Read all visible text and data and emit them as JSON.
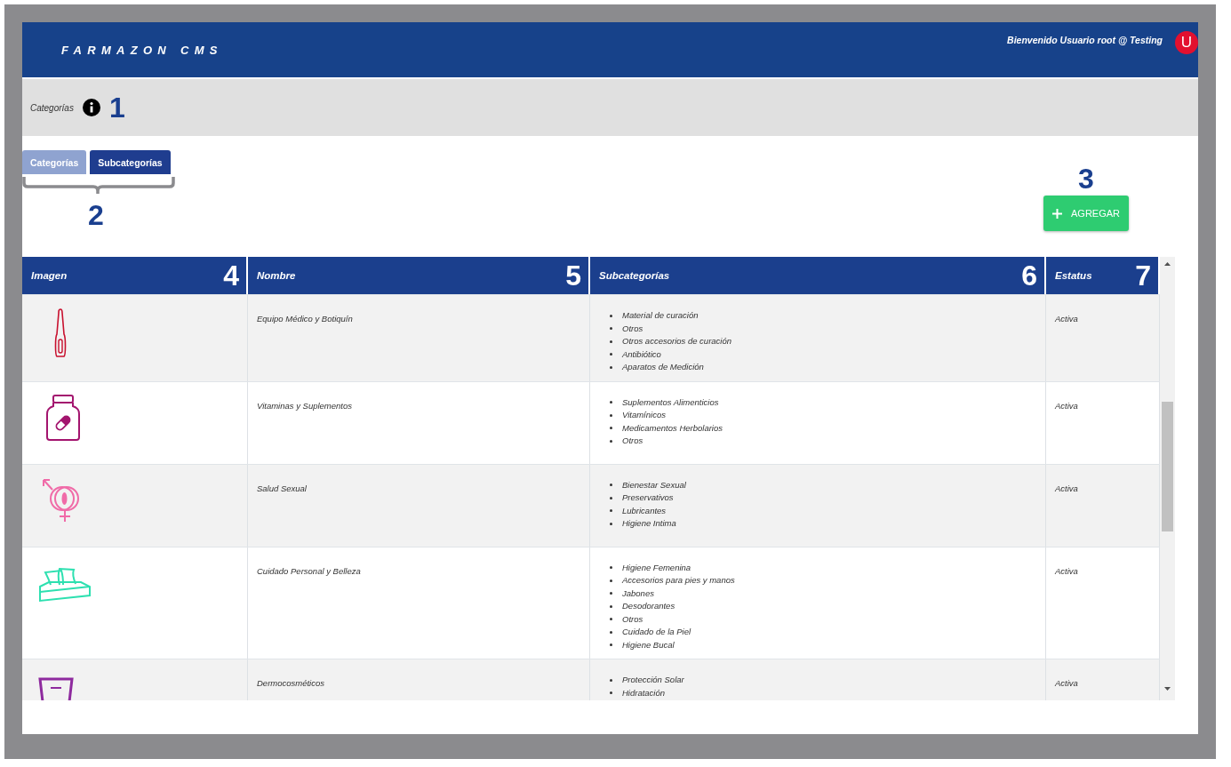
{
  "header": {
    "logo": "FARMAZON CMS",
    "welcome": "Bienvenido Usuario root @ Testing",
    "avatar": "U"
  },
  "breadcrumb": {
    "label": "Categorías",
    "annotation": "1"
  },
  "tabs": [
    {
      "label": "Categorías",
      "selected": false
    },
    {
      "label": "Subcategorías",
      "selected": true
    }
  ],
  "tabs_annotation": "2",
  "add_button": {
    "label": "AGREGAR",
    "annotation": "3"
  },
  "table": {
    "columns": [
      {
        "label": "Imagen",
        "annotation": "4"
      },
      {
        "label": "Nombre",
        "annotation": "5"
      },
      {
        "label": "Subcategorías",
        "annotation": "6"
      },
      {
        "label": "Estatus",
        "annotation": "7"
      }
    ],
    "rows": [
      {
        "name": "Equipo Médico y Botiquín",
        "subcategories": [
          "Material de curación",
          "Otros",
          "Otros accesorios de curación",
          "Antibiótico",
          "Aparatos de Medición"
        ],
        "status": "Activa"
      },
      {
        "name": "Vitaminas y Suplementos",
        "subcategories": [
          "Suplementos Alimenticios",
          "Vitamínicos",
          "Medicamentos Herbolarios",
          "Otros"
        ],
        "status": "Activa"
      },
      {
        "name": "Salud Sexual",
        "subcategories": [
          "Bienestar Sexual",
          "Preservativos",
          "Lubricantes",
          "Higiene Intima"
        ],
        "status": "Activa"
      },
      {
        "name": "Cuidado Personal y Belleza",
        "subcategories": [
          "Higiene Femenina",
          "Accesorios para pies y manos",
          "Jabones",
          "Desodorantes",
          "Otros",
          "Cuidado de la Piel",
          "Higiene Bucal"
        ],
        "status": "Activa"
      },
      {
        "name": "Dermocosméticos",
        "subcategories": [
          "Protección Solar",
          "Hidratación"
        ],
        "status": "Activa"
      }
    ]
  }
}
